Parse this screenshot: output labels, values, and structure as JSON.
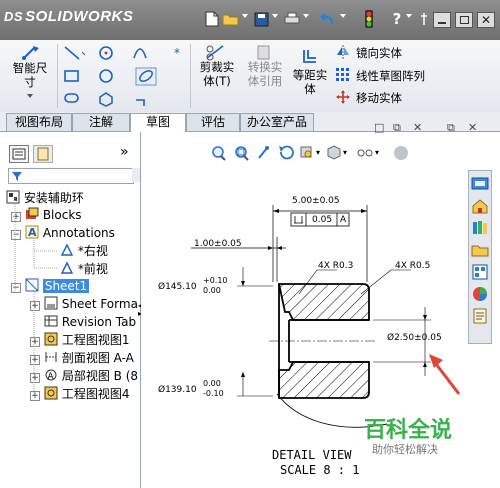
{
  "titlebar": {
    "app_name": "SOLIDWORKS",
    "brand_mark": "DS"
  },
  "ribbon": {
    "smart_dimension": "智能尺寸",
    "trim_entities": "剪裁实体(T)",
    "convert_entities": "转换实体引用",
    "offset_entities": "等距实体",
    "mirror_entities": "镜向实体",
    "linear_pattern": "线性草图阵列",
    "move_entities": "移动实体"
  },
  "tabs": [
    "视图布局",
    "注解",
    "草图",
    "评估",
    "办公室产品"
  ],
  "active_tab": "草图",
  "left_panel": {
    "filter_label": "",
    "tree": [
      {
        "label": "安装辅助环",
        "indent": 0
      },
      {
        "label": "Blocks",
        "indent": 1
      },
      {
        "label": "Annotations",
        "indent": 1
      },
      {
        "label": "*右视",
        "indent": 2
      },
      {
        "label": "*前视",
        "indent": 2
      },
      {
        "label": "Sheet1",
        "indent": 1
      },
      {
        "label": "Sheet Forma",
        "indent": 2
      },
      {
        "label": "Revision Tab",
        "indent": 2
      },
      {
        "label": "工程图视图1",
        "indent": 2
      },
      {
        "label": "剖面视图 A-A",
        "indent": 2
      },
      {
        "label": "局部视图 B (8",
        "indent": 2
      },
      {
        "label": "工程图视图4",
        "indent": 2
      }
    ]
  },
  "drawing": {
    "dim_top": "5.00±0.05",
    "tol_frame_val": "0.05",
    "tol_frame_ref": "A",
    "dim_left_small": "1.00±0.05",
    "chamfer_left": "4X R0.3",
    "chamfer_right": "4X R0.5",
    "dia_upper_main": "Ø145.10",
    "dia_upper_tol_plus": "+0.10",
    "dia_upper_tol_minus": "0.00",
    "dia_right": "Ø2.50±0.05",
    "dia_lower_main": "Ø139.10",
    "dia_lower_tol_plus": "0.00",
    "dia_lower_tol_minus": "-0.10",
    "view_title": "DETAIL VIEW",
    "view_scale": "SCALE 8 : 1"
  },
  "watermark": {
    "title": "百科全说",
    "subtitle": "助你轻松解决"
  },
  "colors": {
    "accent_blue": "#1f5fc8",
    "sheet_highlight": "#3c8be0",
    "arrow_red": "#e04638",
    "watermark_green": "#38b24a"
  }
}
